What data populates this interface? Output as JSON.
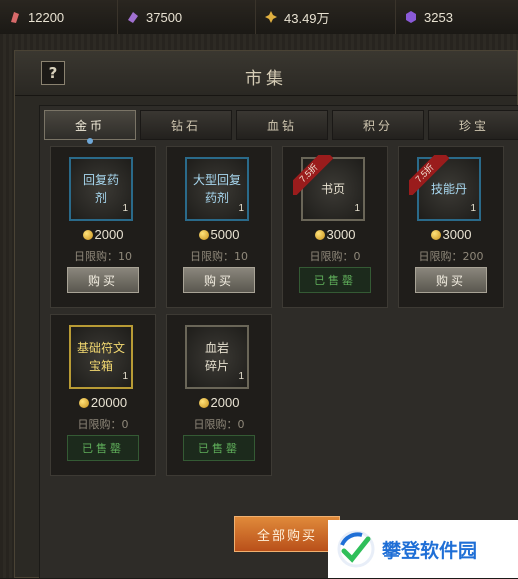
{
  "resources": [
    {
      "icon": "red-crystal-icon",
      "value": "12200",
      "color": "#d86a6a"
    },
    {
      "icon": "purple-crystal-icon",
      "value": "37500",
      "color": "#a070d0"
    },
    {
      "icon": "gold-star-icon",
      "value": "43.49万",
      "color": "#e0b040"
    },
    {
      "icon": "gem-icon",
      "value": "3253",
      "color": "#8a5ad8"
    }
  ],
  "window": {
    "title": "市集",
    "help_label": "?"
  },
  "tabs": [
    {
      "label": "金币",
      "active": true
    },
    {
      "label": "钻石"
    },
    {
      "label": "血钻"
    },
    {
      "label": "积分"
    },
    {
      "label": "珍宝"
    }
  ],
  "items": [
    {
      "name": "回复药剂",
      "qty": "1",
      "price": "2000",
      "limit": "日限购：10",
      "action": "购买",
      "frame": "blue"
    },
    {
      "name": "大型回复药剂",
      "qty": "1",
      "price": "5000",
      "limit": "日限购：10",
      "action": "购买",
      "frame": "blue"
    },
    {
      "name": "书页",
      "qty": "1",
      "price": "3000",
      "limit": "日限购：0",
      "action": "已售罄",
      "discount": "7.5折",
      "frame": "plain"
    },
    {
      "name": "技能丹",
      "qty": "1",
      "price": "3000",
      "limit": "日限购：200",
      "action": "购买",
      "discount": "7.5折",
      "frame": "blue"
    },
    {
      "name": "基础符文宝箱",
      "qty": "1",
      "price": "20000",
      "limit": "日限购：0",
      "action": "已售罄",
      "frame": "gold"
    },
    {
      "name": "血岩碎片",
      "qty": "1",
      "price": "2000",
      "limit": "日限购：0",
      "action": "已售罄",
      "frame": "plain"
    }
  ],
  "buy_all_label": "全部购买",
  "watermark": {
    "text": "攀登软件园",
    "color": "#1f6fd6"
  }
}
